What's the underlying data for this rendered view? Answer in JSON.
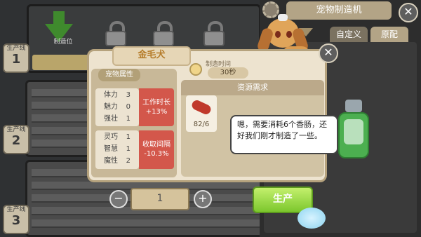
{
  "left_panel": {
    "slot_label": "制造位",
    "lines": [
      {
        "label": "生产线",
        "number": "1"
      },
      {
        "label": "生产线",
        "number": "2"
      },
      {
        "label": "生产线",
        "number": "3"
      }
    ]
  },
  "right_panel": {
    "title": "宠物制造机",
    "tabs": [
      "自定义",
      "原配"
    ],
    "active_tab": "原配"
  },
  "dialog": {
    "pet_name": "金毛犬",
    "time_label": "制造时间",
    "time_value": "30秒",
    "attributes_title": "宠物属性",
    "stat_group_1": [
      {
        "name": "体力",
        "value": "3"
      },
      {
        "name": "魅力",
        "value": "0"
      },
      {
        "name": "强壮",
        "value": "1"
      }
    ],
    "effect_1": {
      "label": "工作时长",
      "value": "+13%"
    },
    "stat_group_2": [
      {
        "name": "灵巧",
        "value": "1"
      },
      {
        "name": "智慧",
        "value": "1"
      },
      {
        "name": "魔性",
        "value": "2"
      }
    ],
    "effect_2": {
      "label": "收取间隔",
      "value": "-10.3%"
    },
    "resource_title": "资源需求",
    "resource_item": {
      "icon": "sausage-icon",
      "count": "82/6"
    },
    "speech": "嗯，需要消耗6个香肠，还好我们刚才制造了一些。",
    "quantity": "1",
    "produce_label": "生产"
  },
  "colors": {
    "accent_green": "#7cc72d",
    "effect_red": "#d3574b",
    "dialog_bg": "#ede3cf"
  }
}
